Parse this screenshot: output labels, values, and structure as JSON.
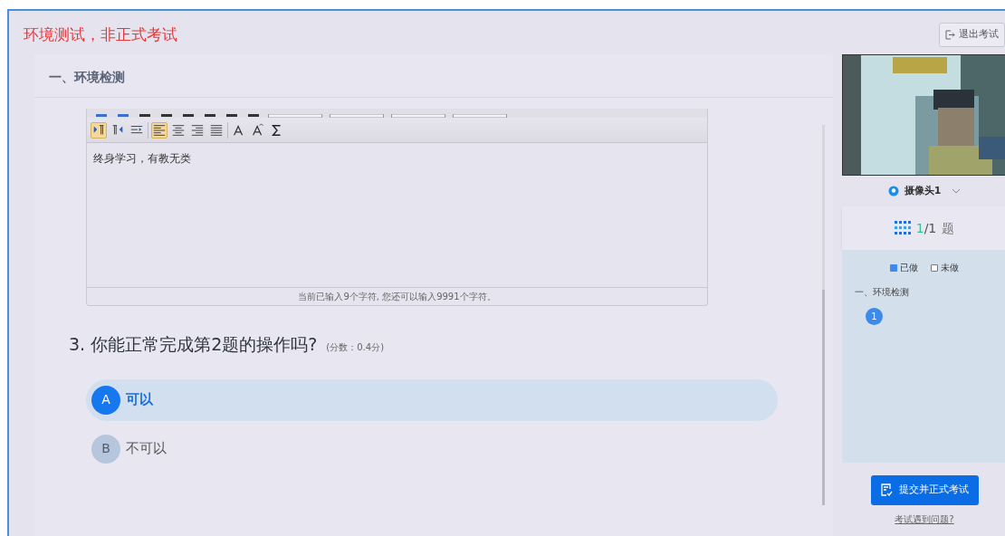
{
  "banner": "环境测试，非正式考试",
  "exit_button": "退出考试",
  "section": {
    "title": "一、环境检测"
  },
  "editor": {
    "toolbar_active": [
      true,
      false,
      false,
      true,
      false,
      false,
      false,
      false,
      false
    ],
    "text": "终身学习，有教无类",
    "footer": "当前已输入9个字符, 您还可以输入9991个字符。"
  },
  "question": {
    "number": "3.",
    "text": "你能正常完成第2题的操作吗?",
    "score": "(分数：0.4分)",
    "options": [
      {
        "letter": "A",
        "label": "可以",
        "selected": true
      },
      {
        "letter": "B",
        "label": "不可以",
        "selected": false
      }
    ]
  },
  "camera": {
    "kind": "picture",
    "label": "摄像头1"
  },
  "counter": {
    "current": "1",
    "total": "/1",
    "unit": "题"
  },
  "legend": [
    {
      "label": "已做",
      "done": true
    },
    {
      "label": "未做",
      "done": false
    }
  ],
  "nav": {
    "section": "一、环境检测",
    "items": [
      {
        "label": "1",
        "done": true
      }
    ]
  },
  "submit_button": "提交并正式考试",
  "help_link": "考试遇到问题?"
}
